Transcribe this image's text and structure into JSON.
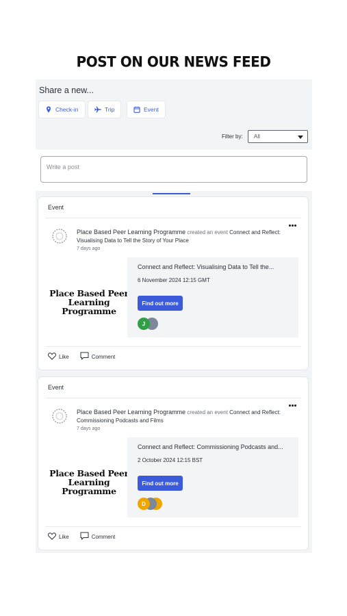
{
  "page_title": "POST ON OUR NEWS FEED",
  "share": {
    "label": "Share a new...",
    "buttons": [
      {
        "label": "Check-in",
        "icon": "map-pin-icon"
      },
      {
        "label": "Trip",
        "icon": "plane-icon"
      },
      {
        "label": "Event",
        "icon": "calendar-icon"
      }
    ]
  },
  "filter": {
    "label": "Filter by:",
    "value": "All"
  },
  "post_input": {
    "placeholder": "Write a post"
  },
  "colors": {
    "accent": "#3b5bdb",
    "background": "#f3f4f6"
  },
  "posts": [
    {
      "type": "Event",
      "author": "Place Based Peer Learning Programme",
      "action": "created an event",
      "event_name": "Connect and Reflect: Visualising Data to Tell the Story of Your Place",
      "time": "7 days ago",
      "logo_text": "Place Based Peer Learning Programme",
      "event_title": "Connect and Reflect: Visualising Data to Tell the...",
      "event_date": "6 November 2024 12:15 GMT",
      "cta": "Find out more",
      "attendees": [
        {
          "initial": "J",
          "color": "#2f9e44"
        },
        {
          "initial": "",
          "color": "#7a8899"
        }
      ],
      "like": "Like",
      "comment": "Comment"
    },
    {
      "type": "Event",
      "author": "Place Based Peer Learning Programme",
      "action": "created an event",
      "event_name": "Connect and Reflect: Commissioning Podcasts and Films",
      "time": "7 days ago",
      "logo_text": "Place Based Peer Learning Programme",
      "event_title": "Connect and Reflect: Commissioning Podcasts and...",
      "event_date": "2 October 2024 12:15 BST",
      "cta": "Find out more",
      "attendees": [
        {
          "initial": "D",
          "color": "#f0a500"
        },
        {
          "initial": "",
          "color": "#7a8899"
        },
        {
          "initial": "",
          "color": "#f0a500"
        }
      ],
      "like": "Like",
      "comment": "Comment"
    }
  ]
}
